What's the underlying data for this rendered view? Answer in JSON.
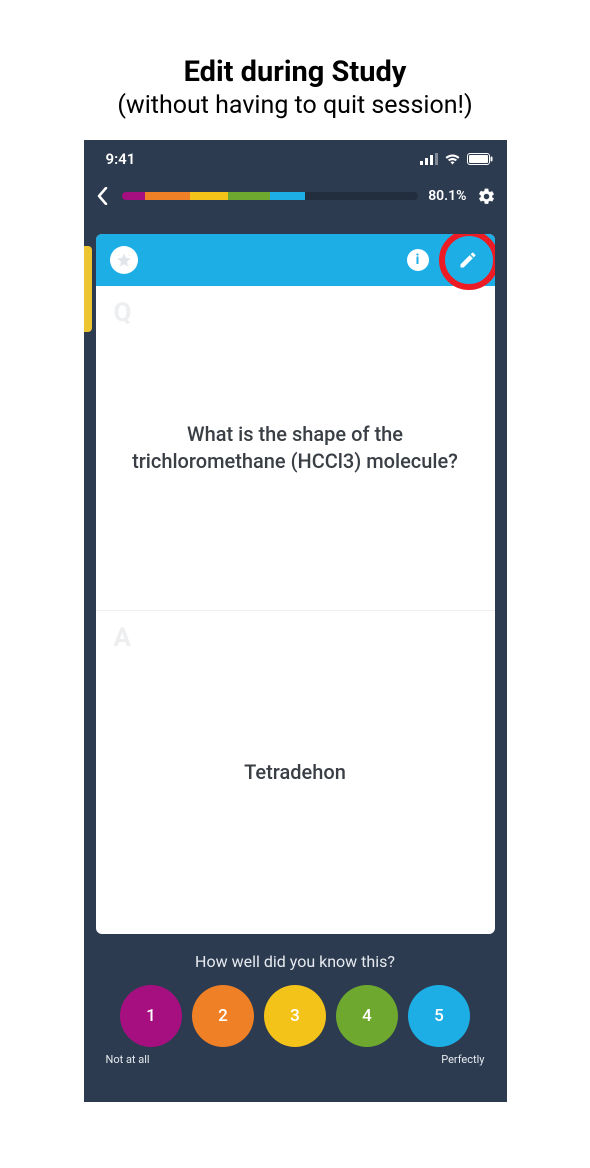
{
  "page": {
    "title": "Edit during Study",
    "subtitle": "(without having to quit session!)"
  },
  "status_bar": {
    "time": "9:41"
  },
  "topbar": {
    "progress_segments": [
      {
        "color": "#a60f7f",
        "width_pct": 8
      },
      {
        "color": "#f08025",
        "width_pct": 15
      },
      {
        "color": "#f3c319",
        "width_pct": 13
      },
      {
        "color": "#6ea82f",
        "width_pct": 14
      },
      {
        "color": "#1daee5",
        "width_pct": 12
      }
    ],
    "percent": "80.1%"
  },
  "card": {
    "question_label": "Q",
    "question": "What is the shape of the trichloromethane (HCCl3) molecule?",
    "answer_label": "A",
    "answer": "Tetradehon"
  },
  "rating": {
    "prompt": "How well did you know this?",
    "buttons": [
      {
        "label": "1",
        "color": "#a60f7f"
      },
      {
        "label": "2",
        "color": "#f08025"
      },
      {
        "label": "3",
        "color": "#f3c319"
      },
      {
        "label": "4",
        "color": "#6ea82f"
      },
      {
        "label": "5",
        "color": "#1daee5"
      }
    ],
    "left_label": "Not at all",
    "right_label": "Perfectly"
  }
}
